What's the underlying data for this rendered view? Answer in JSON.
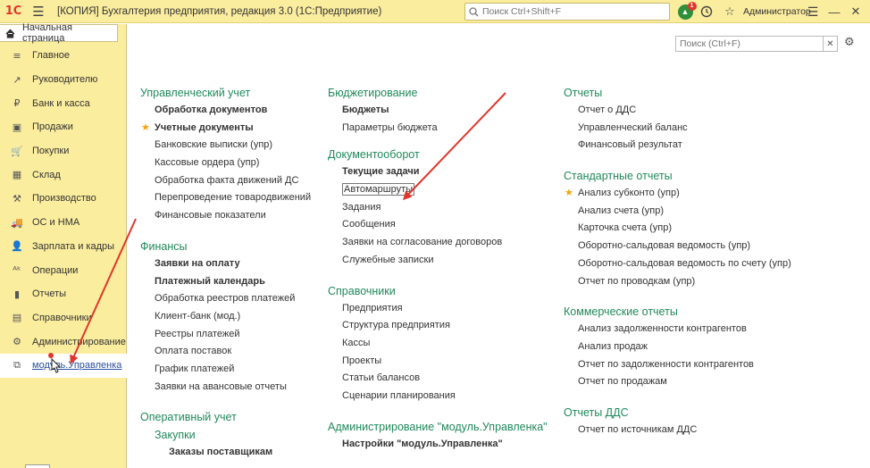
{
  "titlebar": {
    "logo": "1С",
    "title": "[КОПИЯ] Бухгалтерия предприятия, редакция 3.0  (1С:Предприятие)",
    "search_placeholder": "Поиск Ctrl+Shift+F",
    "notification_count": "1",
    "user": "Администратор"
  },
  "sidebar": {
    "home_tab": "Начальная страница",
    "items": [
      {
        "label": "Главное",
        "icon": "≡"
      },
      {
        "label": "Руководителю",
        "icon": "↗"
      },
      {
        "label": "Банк и касса",
        "icon": "₽"
      },
      {
        "label": "Продажи",
        "icon": "▣"
      },
      {
        "label": "Покупки",
        "icon": "🛒"
      },
      {
        "label": "Склад",
        "icon": "▦"
      },
      {
        "label": "Производство",
        "icon": "⚒"
      },
      {
        "label": "ОС и НМА",
        "icon": "🚚"
      },
      {
        "label": "Зарплата и кадры",
        "icon": "👤"
      },
      {
        "label": "Операции",
        "icon": "ᴬᵏ"
      },
      {
        "label": "Отчеты",
        "icon": "▮"
      },
      {
        "label": "Справочники",
        "icon": "▤"
      },
      {
        "label": "Администрирование",
        "icon": "⚙"
      },
      {
        "label": "модуль.Управленка",
        "icon": "⧉"
      }
    ]
  },
  "main": {
    "search_placeholder": "Поиск (Ctrl+F)",
    "col1": {
      "s1_title": "Управленческий учет",
      "s1": [
        "Обработка документов",
        "Учетные документы",
        "Банковские выписки  (упр)",
        "Кассовые ордера  (упр)",
        "Обработка факта движений ДС",
        "Перепроведение товародвижений",
        "Финансовые показатели"
      ],
      "s2_title": "Финансы",
      "s2": [
        "Заявки на оплату",
        "Платежный календарь",
        "Обработка реестров платежей",
        "Клиент-банк (мод.)",
        "Реестры платежей",
        "Оплата поставок",
        "График платежей",
        "Заявки на авансовые отчеты"
      ],
      "s3_title": "Оперативный учет",
      "s3_sub": "Закупки",
      "s3": [
        "Заказы поставщикам"
      ]
    },
    "col2": {
      "s1_title": "Бюджетирование",
      "s1": [
        "Бюджеты",
        "Параметры бюджета"
      ],
      "s2_title": "Документооборот",
      "s2": [
        "Текущие задачи",
        "Автомаршруты",
        "Задания",
        "Сообщения",
        "Заявки на согласование договоров",
        "Служебные записки"
      ],
      "s3_title": "Справочники",
      "s3": [
        "Предприятия",
        "Структура предприятия",
        "Кассы",
        "Проекты",
        "Статьи балансов",
        "Сценарии планирования"
      ],
      "s4_title": "Администрирование \"модуль.Управленка\"",
      "s4": [
        "Настройки \"модуль.Управленка\""
      ]
    },
    "col3": {
      "s1_title": "Отчеты",
      "s1": [
        "Отчет о ДДС",
        "Управленческий баланс",
        "Финансовый результат"
      ],
      "s2_title": "Стандартные отчеты",
      "s2": [
        "Анализ субконто (упр)",
        "Анализ счета (упр)",
        "Карточка счета (упр)",
        "Оборотно-сальдовая ведомость (упр)",
        "Оборотно-сальдовая ведомость по счету (упр)",
        "Отчет по проводкам (упр)"
      ],
      "s3_title": "Коммерческие отчеты",
      "s3": [
        "Анализ задолженности контрагентов",
        "Анализ продаж",
        "Отчет по задолженности контрагентов",
        "Отчет по продажам"
      ],
      "s4_title": "Отчеты ДДС",
      "s4": [
        "Отчет по источникам ДДС"
      ]
    }
  },
  "colors": {
    "accent_bar": "#fbed9e",
    "section_green": "#20895c",
    "favorite_star": "#f4a215",
    "arrow_red": "#e0362c"
  }
}
